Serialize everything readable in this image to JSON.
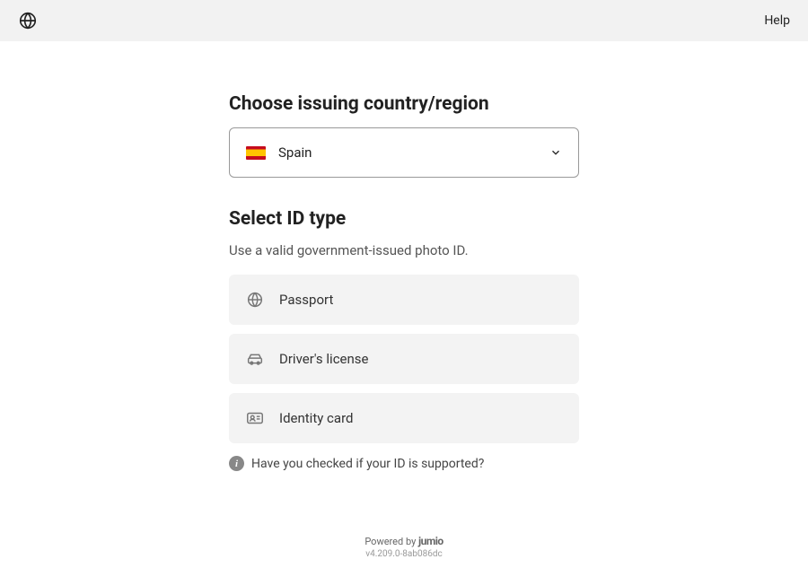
{
  "header": {
    "help_label": "Help"
  },
  "country_section": {
    "title": "Choose issuing country/region",
    "selected_country": "Spain"
  },
  "id_section": {
    "title": "Select ID type",
    "subtitle": "Use a valid government-issued photo ID.",
    "options": [
      {
        "label": "Passport"
      },
      {
        "label": "Driver's license"
      },
      {
        "label": "Identity card"
      }
    ]
  },
  "info": {
    "text": "Have you checked if your ID is supported?"
  },
  "footer": {
    "powered_prefix": "Powered by ",
    "powered_brand": "jumio",
    "version": "v4.209.0-8ab086dc"
  }
}
